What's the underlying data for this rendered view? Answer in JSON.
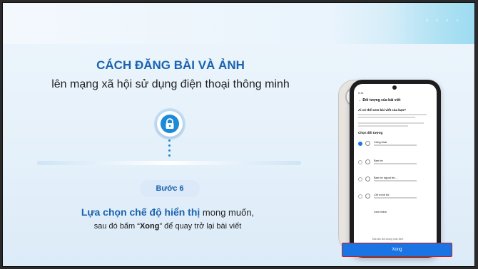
{
  "slide": {
    "title": "CÁCH ĐĂNG BÀI VÀ ẢNH",
    "subtitle": "lên mạng xã hội sử dụng điện thoại thông minh",
    "step_label": "Bước 6",
    "instruction_highlight": "Lựa chọn chế độ hiển thị",
    "instruction_rest": " mong muốn,",
    "instruction2_prefix": "sau đó bấm “",
    "instruction2_bold": "Xong",
    "instruction2_suffix": "” để quay trở lại bài viết",
    "icons": [
      "lock-icon"
    ],
    "accent_color": "#1a63b0"
  },
  "phone": {
    "status_time": "9:41",
    "header": "Đối tượng của bài viết",
    "question": "Ai có thể xem bài viết của bạn?",
    "section_label": "Chọn đối tượng",
    "options": [
      {
        "label": "Công khai",
        "selected": true
      },
      {
        "label": "Bạn bè",
        "selected": false
      },
      {
        "label": "Bạn bè ngoại trừ...",
        "selected": false
      },
      {
        "label": "Chỉ mình tôi",
        "selected": false
      }
    ],
    "more_label": "Xem thêm",
    "default_check": "Đặt làm đối tượng mặc định",
    "done_button": "Xong"
  }
}
